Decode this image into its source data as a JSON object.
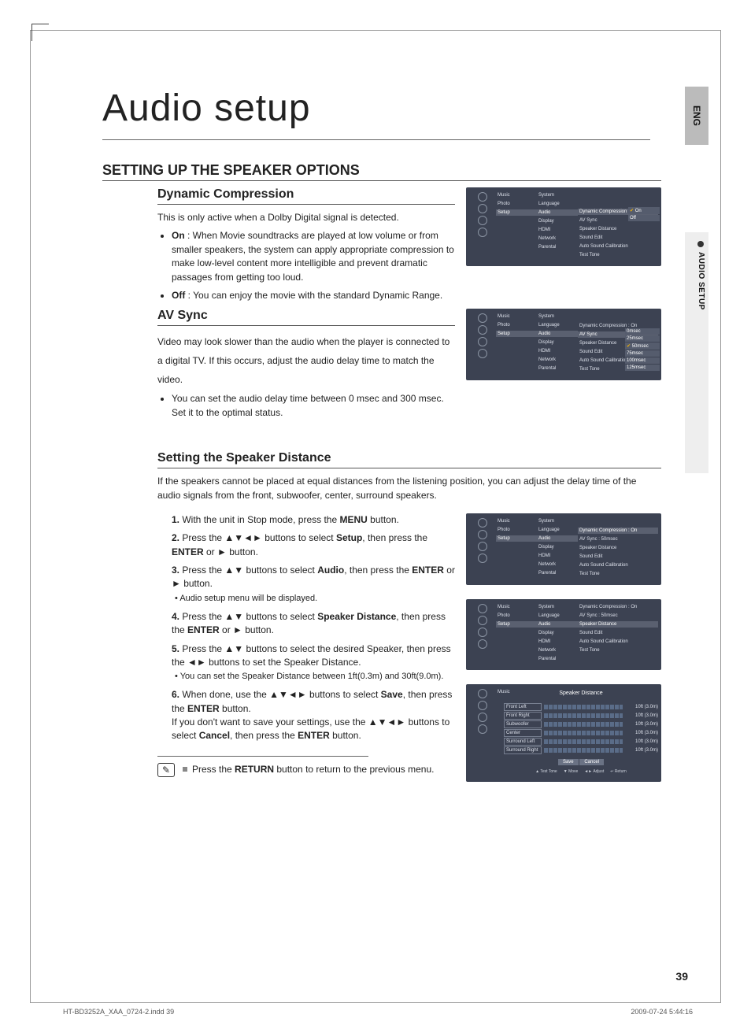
{
  "tabs": {
    "lang": "ENG",
    "section": "AUDIO SETUP"
  },
  "title": "Audio setup",
  "h2": "SETTING UP THE SPEAKER OPTIONS",
  "dc": {
    "heading": "Dynamic Compression",
    "lead": "This is only active when a Dolby Digital signal is detected.",
    "on_b": "On",
    "on_t": " : When Movie soundtracks are played at low volume or from smaller speakers, the system can apply appropriate compression to make low-level content more intelligible and prevent dramatic passages from getting too loud.",
    "off_b": "Off",
    "off_t": " : You can enjoy the movie with the standard Dynamic Range."
  },
  "av": {
    "heading": "AV Sync",
    "para": "Video may look slower than the audio when the player is connected to a digital TV. If this occurs, adjust the audio delay time to match the video.",
    "li": "You can set the audio delay time between 0 msec and 300 msec. Set it to the optimal status."
  },
  "sd": {
    "heading": "Setting the Speaker Distance",
    "lead": "If the speakers cannot be placed at equal distances from the listening position, you can adjust the delay time of the audio signals from the front, subwoofer, center, surround speakers.",
    "s1a": "With the unit in Stop mode, press the ",
    "s1b": "MENU",
    "s1c": " button.",
    "s2a": "Press the ▲▼◄► buttons to select ",
    "s2b": "Setup",
    "s2c": ", then press the ",
    "s2d": "ENTER",
    "s2e": " or ► button.",
    "s3a": "Press the ▲▼ buttons to select ",
    "s3b": "Audio",
    "s3c": ", then press the ",
    "s3d": "ENTER",
    "s3e": " or ► button.",
    "s3n": "Audio setup menu will be displayed.",
    "s4a": "Press the ▲▼ buttons to select ",
    "s4b": "Speaker Distance",
    "s4c": ", then press the ",
    "s4d": "ENTER",
    "s4e": " or ► button.",
    "s5a": "Press the ▲▼ buttons to select the desired Speaker, then press the ◄► buttons to set the Speaker Distance.",
    "s5n": "You can set the Speaker Distance between 1ft(0.3m) and 30ft(9.0m).",
    "s6a": "When done, use the ▲▼◄► buttons to select ",
    "s6b": "Save",
    "s6c": ", then press the ",
    "s6d": "ENTER",
    "s6e": " button.",
    "s6f": "If you don't want to save your settings, use the ▲▼◄► buttons to select ",
    "s6g": "Cancel",
    "s6h": ", then press the ",
    "s6i": "ENTER",
    "s6j": " button."
  },
  "note": {
    "a": "Press the ",
    "b": "RETURN",
    "c": " button to return to the previous menu."
  },
  "nav": {
    "music": "Music",
    "photo": "Photo",
    "setup": "Setup"
  },
  "menu1": {
    "system": "System",
    "language": "Language",
    "audio": "Audio",
    "display": "Display",
    "hdmi": "HDMI",
    "network": "Network",
    "parental": "Parental"
  },
  "menu2": {
    "dc": "Dynamic Compression :",
    "dc_on": "On",
    "av": "AV Sync",
    "sd": "Speaker Distance",
    "se": "Sound Edit",
    "asc": "Auto Sound Calibration",
    "tt": "Test Tone",
    "av50": ": 50msec"
  },
  "dc_opts": {
    "on_v": "On",
    "off_v": "Off"
  },
  "av_opts": [
    "0msec",
    "25msec",
    "50msec",
    "75msec",
    "100msec",
    "125msec"
  ],
  "sd5": {
    "title": "Speaker Distance",
    "rows": [
      "Front Left",
      "Front Right",
      "Subwoofer",
      "Center",
      "Surround Left",
      "Surround Right"
    ],
    "val": "10ft (3.0m)",
    "save": "Save",
    "cancel": "Cancel",
    "foot": {
      "tt": "Test Tone",
      "mv": "Move",
      "ad": "Adjust",
      "rt": "Return"
    }
  },
  "pagenum": "39",
  "footer": {
    "file": "HT-BD3252A_XAA_0724-2.indd   39",
    "stamp": "2009-07-24   5:44:16"
  }
}
